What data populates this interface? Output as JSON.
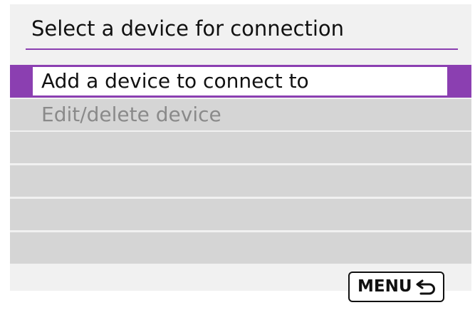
{
  "screen": {
    "title": "Select a device for connection"
  },
  "menu": {
    "items": [
      {
        "label": "Add a device to connect to",
        "selected": true,
        "enabled": true
      },
      {
        "label": "Edit/delete device",
        "selected": false,
        "enabled": false
      },
      {
        "label": "",
        "selected": false,
        "enabled": false
      },
      {
        "label": "",
        "selected": false,
        "enabled": false
      },
      {
        "label": "",
        "selected": false,
        "enabled": false
      },
      {
        "label": "",
        "selected": false,
        "enabled": false
      }
    ]
  },
  "footer": {
    "menu_button_label": "MENU",
    "back_icon": "return-arrow-icon"
  },
  "colors": {
    "accent": "#8b3fb1",
    "background": "#f1f1f1",
    "row_background": "#d5d5d5",
    "disabled_text": "#8a8a8a"
  }
}
